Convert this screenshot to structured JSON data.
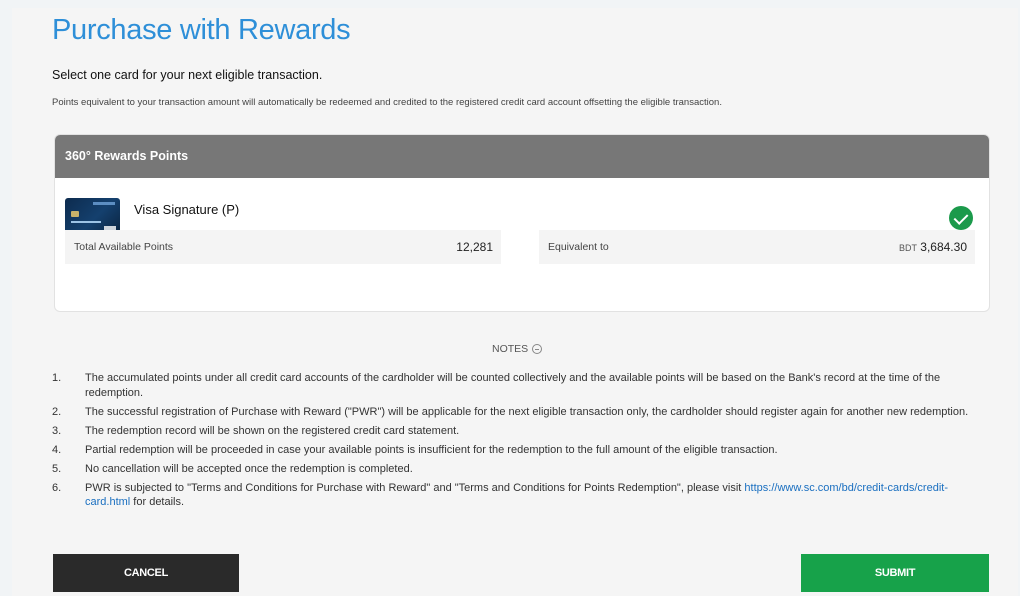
{
  "page": {
    "title": "Purchase with Rewards",
    "subtitle": "Select one card for your next eligible transaction.",
    "description": "Points equivalent to your transaction amount will automatically be redeemed and credited to the registered credit card account offsetting the eligible transaction."
  },
  "rewards_panel": {
    "header": "360° Rewards Points",
    "card_name": "Visa Signature (P)",
    "selected": true,
    "total_points_label": "Total Available Points",
    "total_points_value": "12,281",
    "equivalent_label": "Equivalent to",
    "equivalent_currency": "BDT",
    "equivalent_amount": "3,684.30"
  },
  "notes": {
    "heading": "NOTES",
    "items": [
      {
        "num": "1.",
        "text": "The accumulated points under all credit card accounts of the cardholder will be counted collectively and the available points will be based on the Bank's record at the time of the redemption."
      },
      {
        "num": "2.",
        "text": "The successful registration of Purchase with Reward (\"PWR\") will be applicable for the next eligible transaction only, the cardholder should register again for another new redemption."
      },
      {
        "num": "3.",
        "text": "The redemption record will be shown on the registered credit card statement."
      },
      {
        "num": "4.",
        "text": "Partial redemption will  be proceeded in case your available points is insufficient for the redemption to the full amount of the eligible transaction."
      },
      {
        "num": "5.",
        "text": "No cancellation will be accepted once the redemption is completed."
      },
      {
        "num": "6.",
        "text_before": "PWR is subjected to \"Terms and Conditions for Purchase with Reward\" and \"Terms and Conditions for Points Redemption\", please visit ",
        "link": "https://www.sc.com/bd/credit-cards/credit-card.html",
        "text_after": " for details."
      }
    ]
  },
  "buttons": {
    "cancel": "CANCEL",
    "submit": "SUBMIT"
  },
  "colors": {
    "title": "#2e8fd8",
    "panel_header": "#777777",
    "check": "#1b9a4b",
    "cancel_button": "#2a2a2a",
    "submit_button": "#17a24a",
    "link": "#1a6fc0"
  },
  "icons": {
    "selected": "check-circle-icon",
    "notes_toggle": "minus-circle-icon",
    "card": "credit-card-image"
  }
}
